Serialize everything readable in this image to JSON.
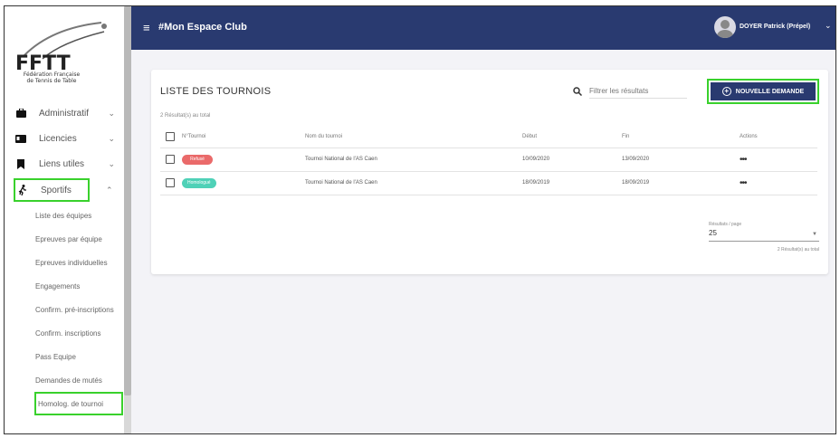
{
  "logo": {
    "line1": "Fédération Française",
    "line2": "de Tennis de Table"
  },
  "sidebar": {
    "items": [
      {
        "label": "Administratif",
        "icon": "briefcase-icon"
      },
      {
        "label": "Licencies",
        "icon": "id-card-icon"
      },
      {
        "label": "Liens utiles",
        "icon": "bookmark-icon"
      },
      {
        "label": "Sportifs",
        "icon": "running-icon"
      }
    ],
    "sub_items": [
      "Liste des équipes",
      "Epreuves par équipe",
      "Epreuves individuelles",
      "Engagements",
      "Confirm. pré-inscriptions",
      "Confirm. inscriptions",
      "Pass Equipe",
      "Demandes de mutés",
      "Homolog. de tournoi"
    ]
  },
  "topbar": {
    "title": "#Mon Espace Club",
    "user": "DOYER Patrick (Prépel)"
  },
  "card": {
    "title": "LISTE DES TOURNOIS",
    "results_count": "2 Résultat(s) au total",
    "search_placeholder": "Filtrer les résultats",
    "new_button": "NOUVELLE DEMANDE",
    "columns": [
      "N°Tournoi",
      "Nom du tournoi",
      "Début",
      "Fin",
      "Actions"
    ],
    "rows": [
      {
        "status": "Refusé",
        "status_color": "#ea6a6a",
        "name": "Tournoi National de l'AS Caen",
        "start": "10/09/2020",
        "end": "13/09/2020",
        "actions": "•••"
      },
      {
        "status": "Homologué",
        "status_color": "#4fd1b7",
        "name": "Tournoi National de l'AS Caen",
        "start": "18/09/2019",
        "end": "18/09/2019",
        "actions": "•••"
      }
    ],
    "pager_label": "Résultats / page",
    "pager_value": "25",
    "pager_total": "2 Résultat(s) au total"
  },
  "colors": {
    "navy": "#293a70",
    "highlight": "#39d12c",
    "refused": "#ea6a6a",
    "approved": "#4fd1b7"
  }
}
